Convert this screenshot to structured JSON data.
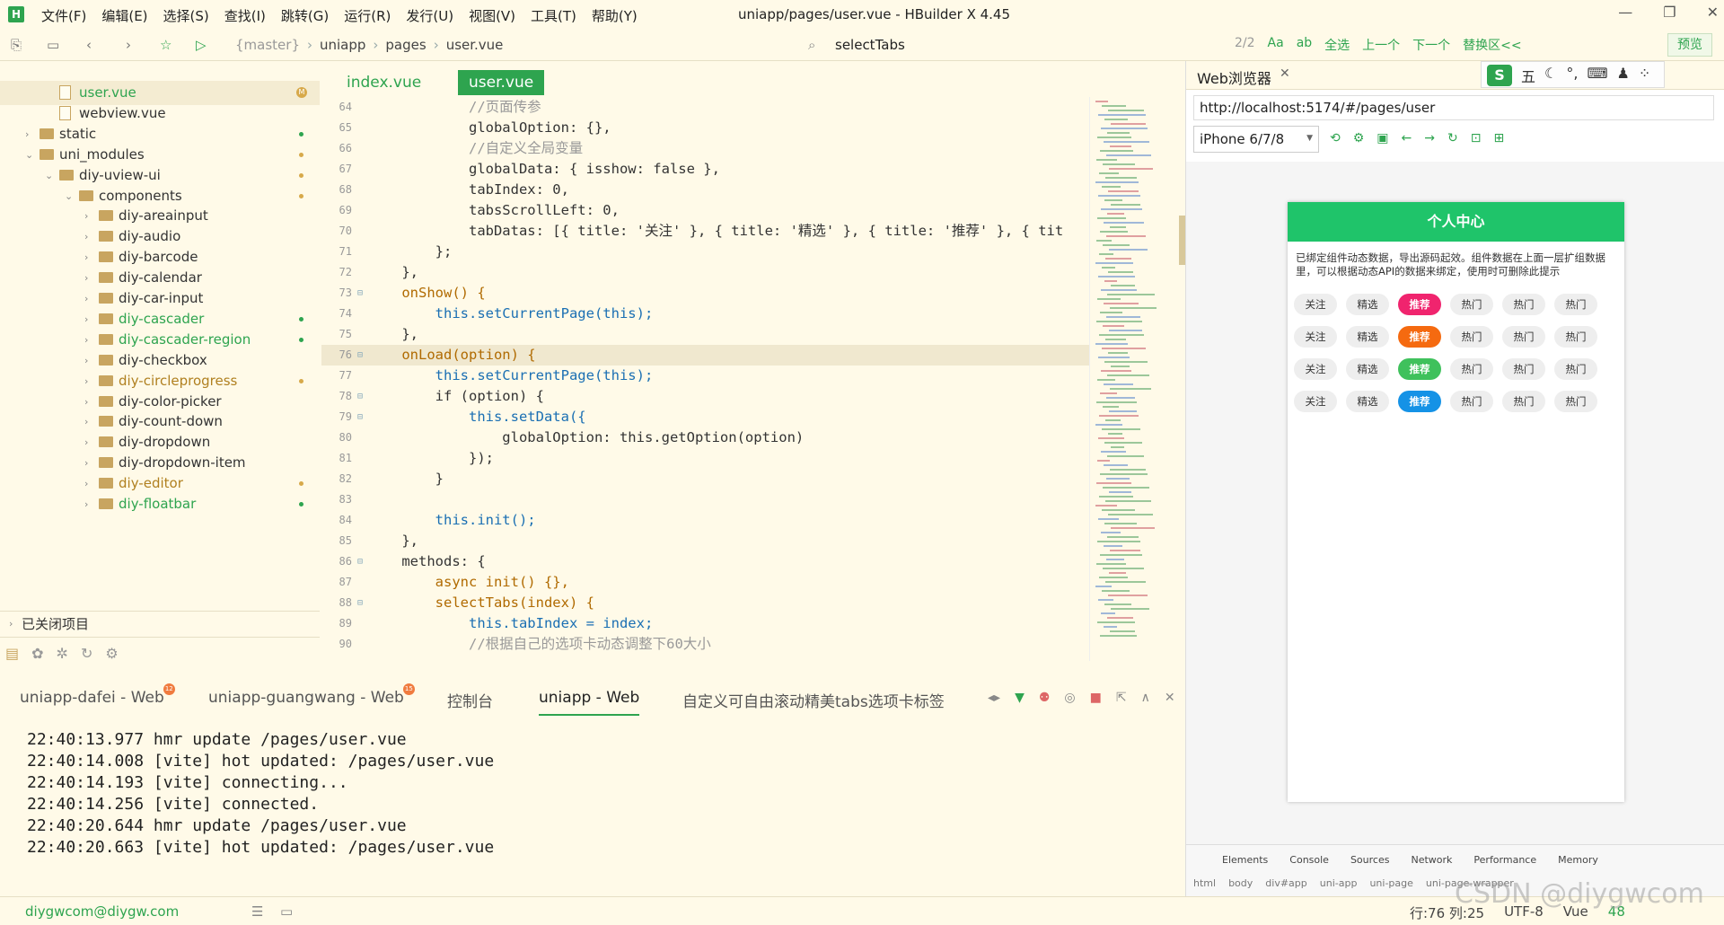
{
  "app": {
    "menus": [
      "文件(F)",
      "编辑(E)",
      "选择(S)",
      "查找(I)",
      "跳转(G)",
      "运行(R)",
      "发行(U)",
      "视图(V)",
      "工具(T)",
      "帮助(Y)"
    ],
    "title": "uniapp/pages/user.vue - HBuilder X 4.45"
  },
  "toolbar": {
    "crumbs": [
      "{master}",
      "uniapp",
      "pages",
      "user.vue"
    ],
    "find_value": "selectTabs",
    "find_count": "2/2",
    "find_tools": [
      "Aa",
      "ab",
      "全选",
      "上一个",
      "下一个",
      "替换区<<"
    ],
    "preview": "预览"
  },
  "sidebar": {
    "items": [
      {
        "label": "user.vue",
        "type": "file",
        "depth": 1,
        "selected": true,
        "badge": "M"
      },
      {
        "label": "webview.vue",
        "type": "file",
        "depth": 1
      },
      {
        "label": "static",
        "type": "folder",
        "depth": 0,
        "arrow": "›",
        "dot": "#2ea44f"
      },
      {
        "label": "uni_modules",
        "type": "folder",
        "depth": 0,
        "arrow": "⌄",
        "dot": "#d7a94a"
      },
      {
        "label": "diy-uview-ui",
        "type": "folder",
        "depth": 1,
        "arrow": "⌄",
        "dot": "#d7a94a"
      },
      {
        "label": "components",
        "type": "folder",
        "depth": 2,
        "arrow": "⌄",
        "dot": "#d7a94a"
      },
      {
        "label": "diy-areainput",
        "type": "folder",
        "depth": 3,
        "arrow": "›"
      },
      {
        "label": "diy-audio",
        "type": "folder",
        "depth": 3,
        "arrow": "›"
      },
      {
        "label": "diy-barcode",
        "type": "folder",
        "depth": 3,
        "arrow": "›"
      },
      {
        "label": "diy-calendar",
        "type": "folder",
        "depth": 3,
        "arrow": "›"
      },
      {
        "label": "diy-car-input",
        "type": "folder",
        "depth": 3,
        "arrow": "›"
      },
      {
        "label": "diy-cascader",
        "type": "folder",
        "depth": 3,
        "arrow": "›",
        "dot": "#2ea44f",
        "color": "#2ea44f"
      },
      {
        "label": "diy-cascader-region",
        "type": "folder",
        "depth": 3,
        "arrow": "›",
        "dot": "#2ea44f",
        "color": "#2ea44f"
      },
      {
        "label": "diy-checkbox",
        "type": "folder",
        "depth": 3,
        "arrow": "›"
      },
      {
        "label": "diy-circleprogress",
        "type": "folder",
        "depth": 3,
        "arrow": "›",
        "dot": "#d7a94a",
        "color": "#b08020"
      },
      {
        "label": "diy-color-picker",
        "type": "folder",
        "depth": 3,
        "arrow": "›"
      },
      {
        "label": "diy-count-down",
        "type": "folder",
        "depth": 3,
        "arrow": "›"
      },
      {
        "label": "diy-dropdown",
        "type": "folder",
        "depth": 3,
        "arrow": "›"
      },
      {
        "label": "diy-dropdown-item",
        "type": "folder",
        "depth": 3,
        "arrow": "›"
      },
      {
        "label": "diy-editor",
        "type": "folder",
        "depth": 3,
        "arrow": "›",
        "dot": "#d7a94a",
        "color": "#b08020"
      },
      {
        "label": "diy-floatbar",
        "type": "folder",
        "depth": 3,
        "arrow": "›",
        "dot": "#2ea44f",
        "color": "#2ea44f"
      }
    ],
    "closed_projects": "已关闭项目"
  },
  "editor": {
    "tabs": [
      "index.vue",
      "user.vue"
    ],
    "lines": [
      {
        "n": "64",
        "t": "            //页面传参",
        "c": "#999"
      },
      {
        "n": "65",
        "t": "            globalOption: {},",
        "c": "#333"
      },
      {
        "n": "66",
        "t": "            //自定义全局变量",
        "c": "#999"
      },
      {
        "n": "67",
        "t": "            globalData: { isshow: false },",
        "c": "#333"
      },
      {
        "n": "68",
        "t": "            tabIndex: 0,",
        "c": "#333"
      },
      {
        "n": "69",
        "t": "            tabsScrollLeft: 0,",
        "c": "#333"
      },
      {
        "n": "70",
        "t": "            tabDatas: [{ title: '关注' }, { title: '精选' }, { title: '推荐' }, { tit",
        "c": "#333"
      },
      {
        "n": "71",
        "t": "        };",
        "c": "#333"
      },
      {
        "n": "72",
        "t": "    },",
        "c": "#333"
      },
      {
        "n": "73",
        "t": "    onShow() {",
        "c": "#b06a00",
        "f": "⊟"
      },
      {
        "n": "74",
        "t": "        this.setCurrentPage(this);",
        "c": "#1a6fb3"
      },
      {
        "n": "75",
        "t": "    },",
        "c": "#333"
      },
      {
        "n": "76",
        "t": "    onLoad(option) {",
        "c": "#b06a00",
        "f": "⊟",
        "hl": true
      },
      {
        "n": "77",
        "t": "        this.setCurrentPage(this);",
        "c": "#1a6fb3"
      },
      {
        "n": "78",
        "t": "        if (option) {",
        "c": "#333",
        "f": "⊟"
      },
      {
        "n": "79",
        "t": "            this.setData({",
        "c": "#1a6fb3",
        "f": "⊟"
      },
      {
        "n": "80",
        "t": "                globalOption: this.getOption(option)",
        "c": "#333"
      },
      {
        "n": "81",
        "t": "            });",
        "c": "#333"
      },
      {
        "n": "82",
        "t": "        }",
        "c": "#333"
      },
      {
        "n": "83",
        "t": "",
        "c": "#333"
      },
      {
        "n": "84",
        "t": "        this.init();",
        "c": "#1a6fb3"
      },
      {
        "n": "85",
        "t": "    },",
        "c": "#333"
      },
      {
        "n": "86",
        "t": "    methods: {",
        "c": "#333",
        "f": "⊟"
      },
      {
        "n": "87",
        "t": "        async init() {},",
        "c": "#b06a00"
      },
      {
        "n": "88",
        "t": "        selectTabs(index) {",
        "c": "#b06a00",
        "f": "⊟"
      },
      {
        "n": "89",
        "t": "            this.tabIndex = index;",
        "c": "#1a6fb3"
      },
      {
        "n": "90",
        "t": "            //根据自己的选项卡动态调整下60大小",
        "c": "#999"
      }
    ]
  },
  "console": {
    "tabs": [
      {
        "label": "uniapp-dafei - Web",
        "badge": "12"
      },
      {
        "label": "uniapp-guangwang - Web",
        "badge": "15"
      },
      {
        "label": "控制台"
      },
      {
        "label": "uniapp - Web",
        "active": true
      },
      {
        "label": "自定义可自由滚动精美tabs选项卡标签"
      }
    ],
    "lines": [
      "22:40:13.977 hmr update /pages/user.vue",
      "22:40:14.008 [vite] hot updated: /pages/user.vue",
      "22:40:14.193 [vite] connecting...",
      "22:40:14.256 [vite] connected.",
      "22:40:20.644 hmr update /pages/user.vue",
      "22:40:20.663 [vite] hot updated: /pages/user.vue"
    ]
  },
  "status": {
    "user": "diygwcom@diygw.com",
    "position": "行:76  列:25",
    "encoding": "UTF-8",
    "lang": "Vue",
    "count": "48"
  },
  "browser": {
    "tab_label": "Web浏览器",
    "ime": [
      "五"
    ],
    "url": "http://localhost:5174/#/pages/user",
    "device": "iPhone 6/7/8",
    "page": {
      "header": "个人中心",
      "note": "已绑定组件动态数据，导出源码起效。组件数据在上面一层扩组数据里，可以根据动态API的数据来绑定，使用时可删除此提示",
      "rows": [
        {
          "accent": "#f0246e",
          "labels": [
            "关注",
            "精选",
            "推荐",
            "热门",
            "热门",
            "热门"
          ]
        },
        {
          "accent": "#f56a10",
          "labels": [
            "关注",
            "精选",
            "推荐",
            "热门",
            "热门",
            "热门"
          ]
        },
        {
          "accent": "#3fc15c",
          "labels": [
            "关注",
            "精选",
            "推荐",
            "热门",
            "热门",
            "热门"
          ]
        },
        {
          "accent": "#1592e6",
          "labels": [
            "关注",
            "精选",
            "推荐",
            "热门",
            "热门",
            "热门"
          ]
        }
      ]
    },
    "devtools_tabs": [
      "Elements",
      "Console",
      "Sources",
      "Network",
      "Performance",
      "Memory"
    ],
    "devtools_path": [
      "html",
      "body",
      "div#app",
      "uni-app",
      "uni-page",
      "uni-page-wrapper"
    ]
  },
  "watermark": "CSDN @diygwcom"
}
